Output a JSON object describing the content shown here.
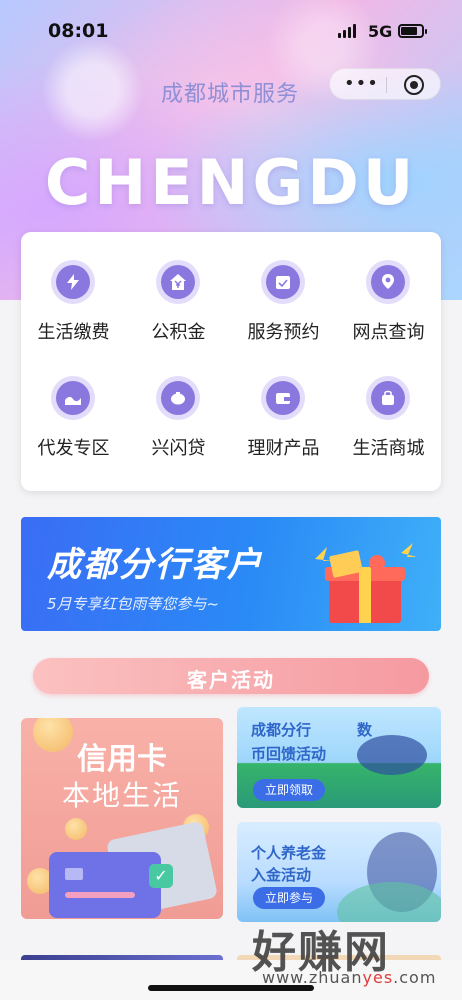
{
  "status_bar": {
    "time": "08:01",
    "network": "5G"
  },
  "header": {
    "title": "成都城市服务",
    "hero_word": "CHENGDU",
    "capsule_more": "•••"
  },
  "services": [
    {
      "label": "生活缴费",
      "icon": "lightning-bolt-icon"
    },
    {
      "label": "公积金",
      "icon": "house-yen-icon"
    },
    {
      "label": "服务预约",
      "icon": "calendar-check-icon"
    },
    {
      "label": "网点查询",
      "icon": "location-pin-icon"
    },
    {
      "label": "代发专区",
      "icon": "wave-icon"
    },
    {
      "label": "兴闪贷",
      "icon": "piggy-bank-icon"
    },
    {
      "label": "理财产品",
      "icon": "wallet-icon"
    },
    {
      "label": "生活商城",
      "icon": "shopping-bag-icon"
    }
  ],
  "banner": {
    "title": "成都分行客户",
    "subtitle": "5月专享红包雨等您参与~"
  },
  "activities": {
    "header": "客户活动",
    "credit_card": {
      "line1": "信用卡",
      "line2": "本地生活"
    },
    "promo1": {
      "line1": "成都分行",
      "line1_extra": "数",
      "line2": "币回馈活动",
      "button": "立即领取"
    },
    "promo2": {
      "line1": "个人养老金",
      "line2": "入金活动",
      "button": "立即参与"
    }
  },
  "watermark": {
    "text": "好赚网",
    "url_prefix": "www.zhuan",
    "url_highlight": "yes",
    "url_suffix": ".com"
  },
  "colors": {
    "accent": "#8a78df",
    "banner_blue": "#2a8af6",
    "activity_pink": "#f59aa0",
    "title_purple": "#8f8fd6"
  }
}
